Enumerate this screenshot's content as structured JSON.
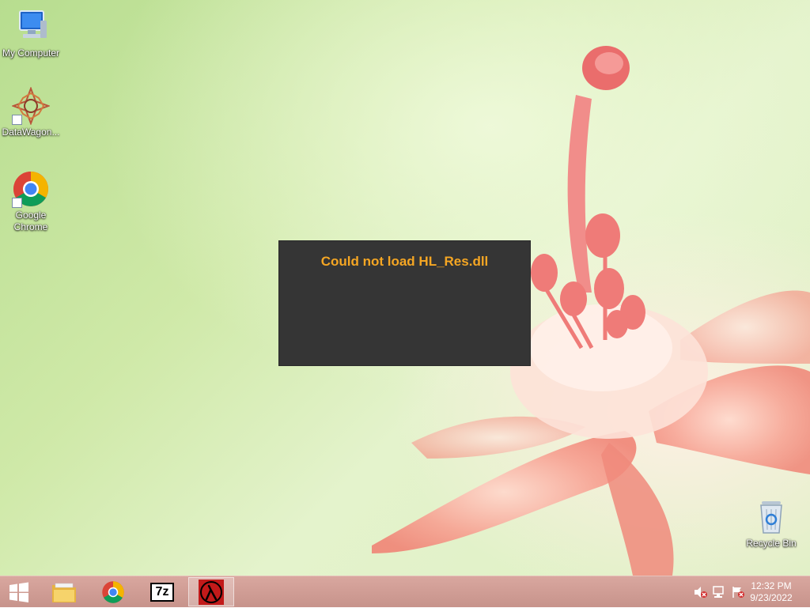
{
  "desktop": {
    "icons": [
      {
        "label": "My Computer",
        "icon": "computer-icon"
      },
      {
        "label": "DataWagon...",
        "icon": "datawagon-icon"
      },
      {
        "label": "Google Chrome",
        "icon": "chrome-icon"
      },
      {
        "label": "Recycle Bin",
        "icon": "recycle-bin-icon"
      }
    ]
  },
  "dialog": {
    "message": "Could not load HL_Res.dll",
    "message_color": "#f5a623",
    "background": "#353535"
  },
  "taskbar": {
    "color": "#d1a098",
    "pinned": [
      {
        "icon": "start-windows-icon"
      },
      {
        "icon": "file-explorer-icon"
      },
      {
        "icon": "chrome-icon"
      },
      {
        "icon": "7zip-icon",
        "text": "7z"
      },
      {
        "icon": "half-life-lambda-icon",
        "active": true
      }
    ],
    "tray": {
      "icons": [
        "volume-muted-icon",
        "network-icon",
        "action-center-icon"
      ],
      "time": "12:32 PM",
      "date": "9/23/2022"
    }
  }
}
